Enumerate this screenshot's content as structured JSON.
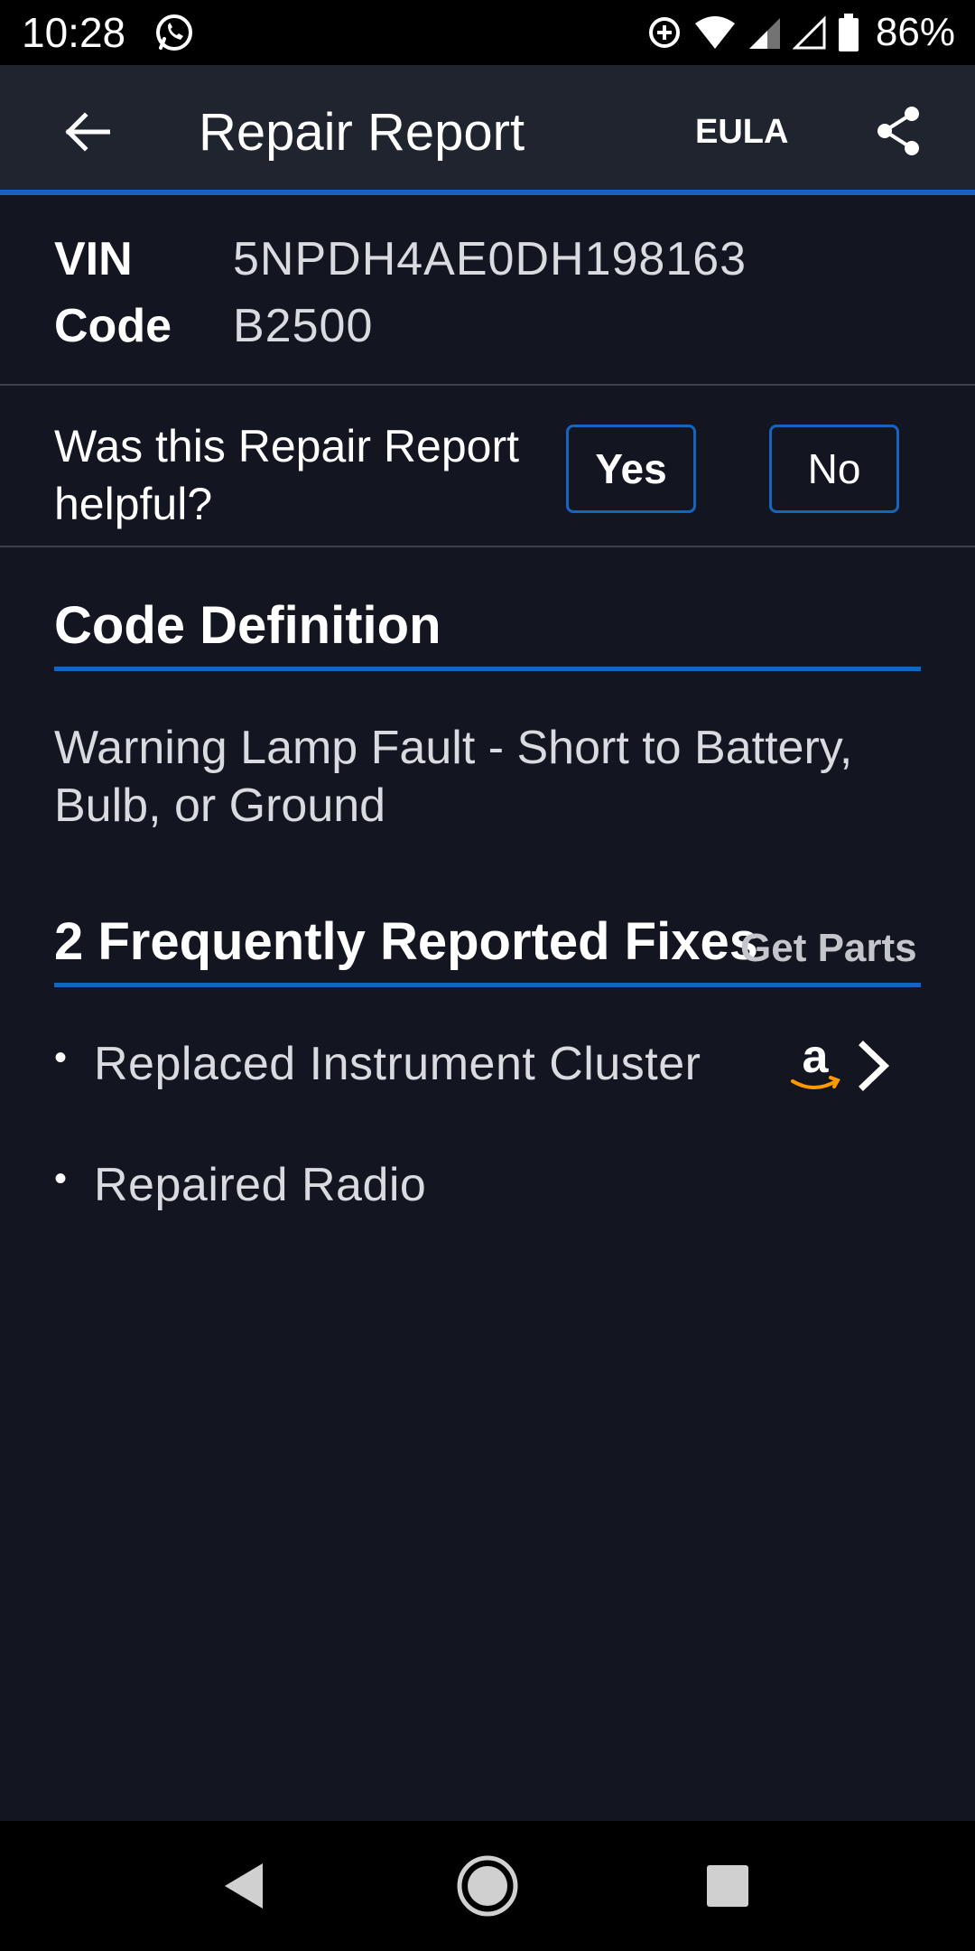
{
  "status_bar": {
    "time": "10:28",
    "battery_percent": "86%",
    "icons": [
      "whatsapp-icon",
      "data-saver-icon",
      "wifi-icon",
      "signal-icon",
      "signal-empty-icon",
      "battery-icon"
    ]
  },
  "app_bar": {
    "title": "Repair Report",
    "eula_label": "EULA",
    "back_icon": "arrow-left-icon",
    "share_icon": "share-icon"
  },
  "vehicle": {
    "vin_label": "VIN",
    "vin_value": "5NPDH4AE0DH198163",
    "code_label": "Code",
    "code_value": "B2500"
  },
  "feedback": {
    "question": "Was this Repair Report helpful?",
    "yes_label": "Yes",
    "no_label": "No"
  },
  "code_definition": {
    "title": "Code Definition",
    "text": "Warning Lamp Fault - Short to Battery, Bulb, or Ground"
  },
  "fixes": {
    "title": "2 Frequently Reported Fixes",
    "get_parts_label": "Get Parts",
    "items": [
      {
        "label": "Replaced Instrument Cluster",
        "has_amazon_link": true
      },
      {
        "label": "Repaired Radio",
        "has_amazon_link": false
      }
    ]
  },
  "nav_bar": {
    "icons": [
      "back-triangle-icon",
      "home-circle-icon",
      "recents-square-icon"
    ]
  },
  "colors": {
    "background": "#131621",
    "app_bar": "#1f242e",
    "accent": "#1565c0",
    "amazon_orange": "#f90"
  }
}
